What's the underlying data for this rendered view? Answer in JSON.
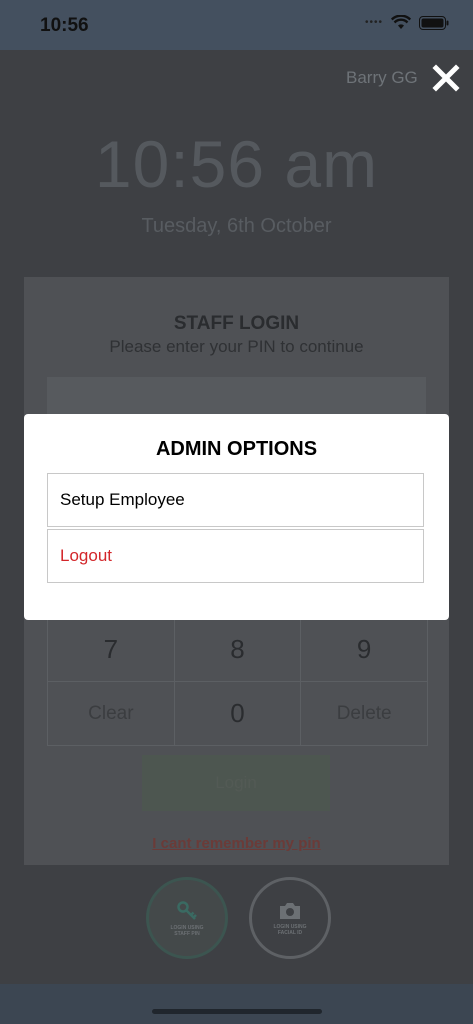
{
  "status_bar": {
    "time": "10:56"
  },
  "header": {
    "user_name": "Barry GG"
  },
  "clock": {
    "time": "10:56 am",
    "date": "Tuesday, 6th October"
  },
  "login_card": {
    "title": "STAFF LOGIN",
    "subtitle": "Please enter your PIN to continue",
    "keypad": [
      "7",
      "8",
      "9",
      "Clear",
      "0",
      "Delete"
    ],
    "login_label": "Login",
    "forgot_label": "I cant remember my pin"
  },
  "login_modes": {
    "pin_label": "LOGIN USING STAFF PIN",
    "face_label": "LOGIN USING FACIAL ID"
  },
  "modal": {
    "title": "ADMIN OPTIONS",
    "options": [
      "Setup Employee",
      "Logout"
    ]
  },
  "colors": {
    "logout": "#d3262a",
    "overlay": "#3e4044",
    "accent_pin": "#3c5550"
  }
}
